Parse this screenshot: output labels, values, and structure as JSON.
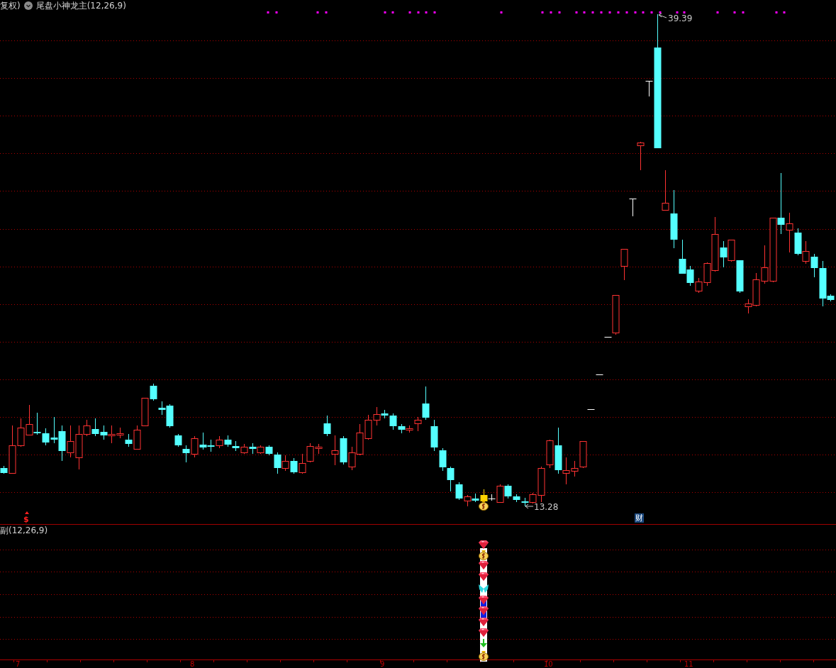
{
  "header": {
    "adjust_label": "复权)",
    "indicator_title": "尾盘小神龙主(12,26,9)"
  },
  "main_chart": {
    "high_label": "39.39",
    "low_label": "13.28",
    "signal_marker": "$",
    "news_badge": "财"
  },
  "sub_chart": {
    "title": "副(12,26,9)"
  },
  "x_axis": {
    "labels": [
      "7",
      "8",
      "9",
      "10",
      "11"
    ]
  }
}
